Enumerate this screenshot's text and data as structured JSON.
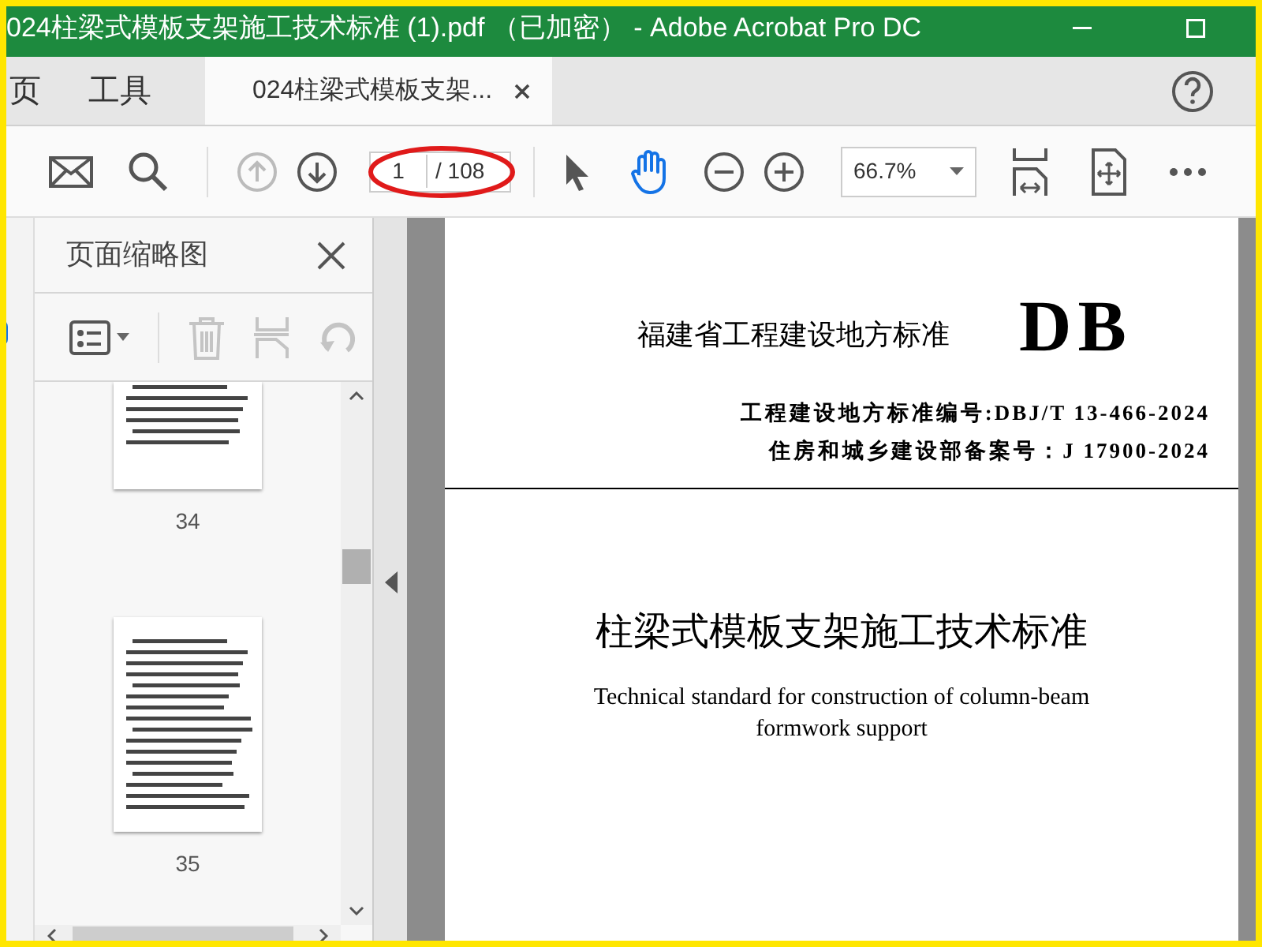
{
  "window": {
    "title": "024柱梁式模板支架施工技术标准 (1).pdf （已加密） - Adobe Acrobat Pro DC"
  },
  "menu_tabs": [
    {
      "label": "页",
      "selected": false
    },
    {
      "label": "工具",
      "selected": false
    }
  ],
  "document_tab": {
    "label": "024柱梁式模板支架...",
    "selected": true
  },
  "toolbar": {
    "page_number": "1",
    "page_count": "/ 108",
    "zoom": "66.7%"
  },
  "thumbnails_panel": {
    "title": "页面缩略图",
    "pages": [
      {
        "label": "34"
      },
      {
        "label": "35"
      }
    ]
  },
  "document": {
    "heading": "福建省工程建设地方标准",
    "logo": "DB",
    "standard_number": "工程建设地方标准编号:DBJ/T 13-466-2024",
    "record_number": "住房和城乡建设部备案号：J 17900-2024",
    "title_zh": "柱梁式模板支架施工技术标准",
    "title_en": "Technical standard for construction of column-beam formwork support"
  }
}
